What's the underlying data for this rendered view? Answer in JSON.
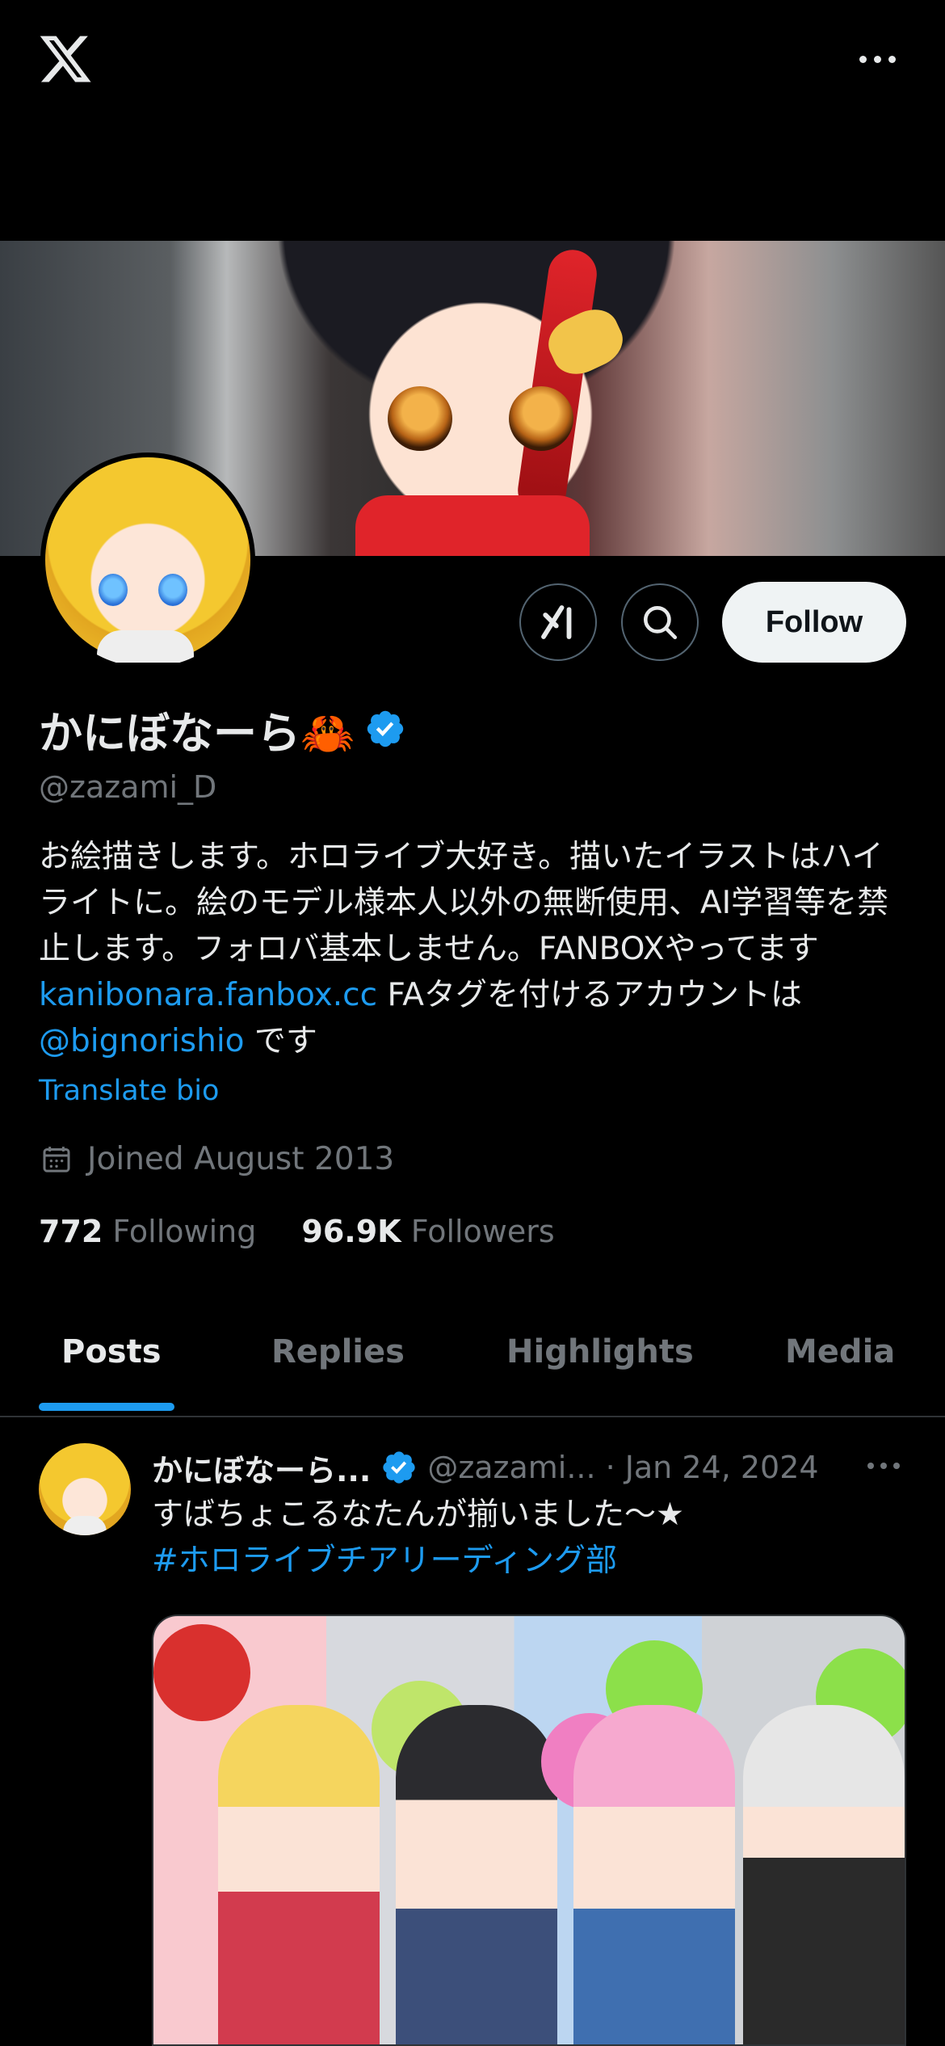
{
  "app": {
    "logo": "x-logo-icon"
  },
  "profile": {
    "display_name": "かにぼなーら🦀",
    "handle": "@zazami_D",
    "bio_parts": {
      "p1": "お絵描きします。ホロライブ大好き。描いたイラストはハイライトに。絵のモデル様本人以外の無断使用、AI学習等を禁止します。フォロバ基本しません。FANBOXやってます ",
      "link1": "kanibonara.fanbox.cc",
      "p2": " FAタグを付けるアカウントは",
      "link2": "@bignorishio",
      "p3": " です"
    },
    "translate_label": "Translate bio",
    "joined": "Joined August 2013",
    "following_count": "772",
    "following_label": "Following",
    "followers_count": "96.9K",
    "followers_label": "Followers"
  },
  "actions": {
    "follow_label": "Follow"
  },
  "tabs": [
    "Posts",
    "Replies",
    "Highlights",
    "Media"
  ],
  "post": {
    "name": "かにぼなーら...",
    "handle": "@zazami...",
    "dot": "·",
    "date": "Jan 24, 2024",
    "text_line1": "すばちょこるなたんが揃いました〜★",
    "hashtag": "#ホロライブチアリーディング部"
  },
  "colors": {
    "background": "#000000",
    "accent": "#1d9bf0",
    "secondary_text": "#71767b",
    "primary_text": "#e7e9ea",
    "follow_button_bg": "#eff3f4"
  }
}
